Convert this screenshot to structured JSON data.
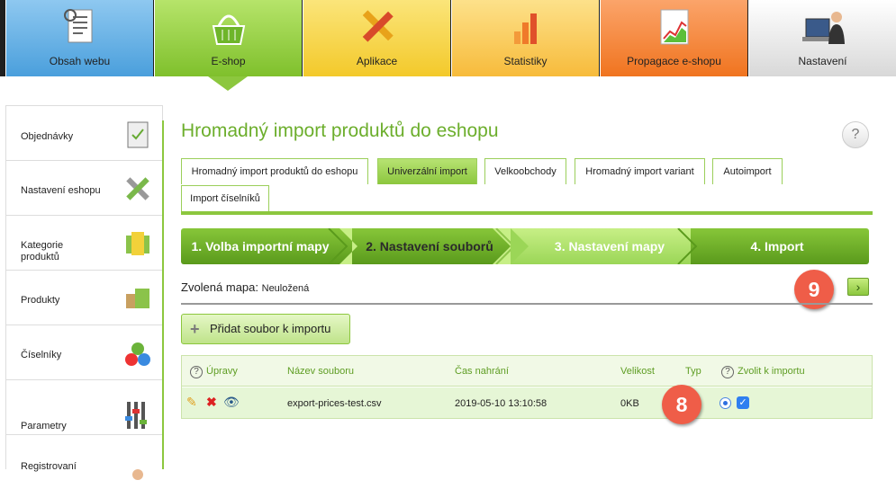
{
  "nav": {
    "tabs": [
      {
        "label": "Obsah webu",
        "icon": "document-list-icon"
      },
      {
        "label": "E-shop",
        "icon": "basket-icon"
      },
      {
        "label": "Aplikace",
        "icon": "tools-icon"
      },
      {
        "label": "Statistiky",
        "icon": "bar-chart-icon"
      },
      {
        "label": "Propagace e-shopu",
        "icon": "line-chart-icon"
      },
      {
        "label": "Nastavení",
        "icon": "user-computer-icon"
      }
    ]
  },
  "sidebar": {
    "items": [
      {
        "label": "Objednávky",
        "icon": "clipboard-icon"
      },
      {
        "label": "Nastavení eshopu",
        "icon": "wrench-screwdriver-icon"
      },
      {
        "label": "Kategorie produktů",
        "icon": "folder-icon"
      },
      {
        "label": "Produkty",
        "icon": "boxes-icon"
      },
      {
        "label": "Číselníky",
        "icon": "numbers-icon"
      },
      {
        "label": "Parametry",
        "icon": "sliders-icon"
      },
      {
        "label": "Registrovaní",
        "icon": "users-icon"
      }
    ]
  },
  "page": {
    "title": "Hromadný import produktů do eshopu",
    "help": "?"
  },
  "tabs": [
    "Hromadný import produktů do eshopu",
    "Univerzální import",
    "Velkoobchody",
    "Hromadný import variant",
    "Autoimport",
    "Import číselníků"
  ],
  "active_tab": "Univerzální import",
  "steps": [
    "1. Volba importní mapy",
    "2. Nastavení souborů",
    "3. Nastavení mapy",
    "4. Import"
  ],
  "active_step": "2. Nastavení souborů",
  "map": {
    "label": "Zvolená mapa:",
    "value": "Neuložená",
    "next": "›"
  },
  "badges": {
    "nine": "9",
    "eight": "8"
  },
  "add_button": "Přidat soubor k importu",
  "table": {
    "headers": {
      "edits": "Úpravy",
      "name": "Název souboru",
      "time": "Čas nahrání",
      "size": "Velikost",
      "type": "Typ",
      "choose": "Zvolit k importu"
    },
    "rows": [
      {
        "name": "export-prices-test.csv",
        "time": "2019-05-10 13:10:58",
        "size": "0KB"
      }
    ]
  },
  "colors": {
    "accent": "#8cc73e",
    "title": "#6cae2c",
    "badge": "#ef5d48"
  }
}
